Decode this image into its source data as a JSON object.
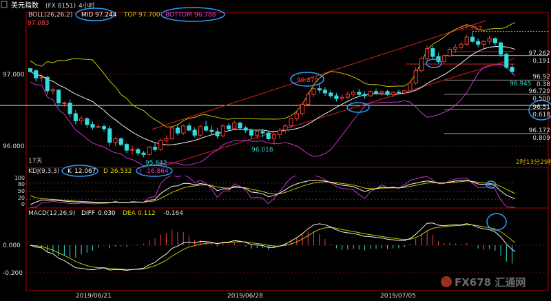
{
  "header": {
    "title": "美元指数",
    "symbol": "(FX 8151)",
    "period": "4小时"
  },
  "boll": {
    "label": "BOLL(26,26,2)",
    "mid_label": "MID",
    "mid": "97.244",
    "top_label": "TOP",
    "top": "97.700",
    "bottom_label": "BOTTOM",
    "bottom": "96.788"
  },
  "kdj": {
    "label": "KDJ(9,3,3)",
    "k_label": "K",
    "k": "12.067",
    "d_label": "D",
    "d": "26.532",
    "j_label": "J",
    "j": "-16.864"
  },
  "macd": {
    "label": "MACD(12,26,9)",
    "diff_label": "DIFF",
    "diff": "0.030",
    "dea_label": "DEA",
    "dea": "0.112",
    "macd": "-0.164"
  },
  "price_axis": [
    "97.000",
    "96.000"
  ],
  "kdj_axis": [
    "100",
    "80",
    "50",
    "20",
    "0"
  ],
  "macd_axis": [
    "0.000",
    "-0.200"
  ],
  "dates": [
    "2019/06/21",
    "2019/06/28",
    "2019/07/05"
  ],
  "annotations": {
    "left_high": "97.083",
    "low": "95.842",
    "mid_low": "96.018",
    "mid_high": "96.879",
    "right_high": "97.593",
    "last": "96.945",
    "days": "17天",
    "countdown": "2时13分29秒"
  },
  "fib_levels": [
    "97.262",
    "0.191",
    "96.92",
    "0.38",
    "96.720",
    "0.500",
    "96.51",
    "0.618",
    "96.172",
    "0.809"
  ],
  "watermark": "FX678 汇通网",
  "colors": {
    "up": "#ff3b3b",
    "down": "#33dddd",
    "mid": "#f0f0f0",
    "top": "#c8c800",
    "bottom": "#cc33cc",
    "channel": "#e02020",
    "highlight": "#2aa0ff"
  },
  "chart_data": {
    "type": "candlestick",
    "x_labels": [
      "2019/06/21",
      "2019/06/28",
      "2019/07/05"
    ],
    "ylim": [
      95.7,
      97.75
    ],
    "candles": [
      [
        97.08,
        97.08,
        97.06,
        97.04
      ],
      [
        97.05,
        97.07,
        96.9,
        96.95
      ],
      [
        96.95,
        96.98,
        96.9,
        96.96
      ],
      [
        96.96,
        96.97,
        96.72,
        96.77
      ],
      [
        96.77,
        96.82,
        96.72,
        96.79
      ],
      [
        96.78,
        96.79,
        96.55,
        96.6
      ],
      [
        96.6,
        96.62,
        96.55,
        96.6
      ],
      [
        96.6,
        96.65,
        96.4,
        96.45
      ],
      [
        96.45,
        96.5,
        96.3,
        96.35
      ],
      [
        96.35,
        96.42,
        96.3,
        96.38
      ],
      [
        96.38,
        96.4,
        96.25,
        96.3
      ],
      [
        96.3,
        96.34,
        96.23,
        96.26
      ],
      [
        96.26,
        96.3,
        96.25,
        96.27
      ],
      [
        96.27,
        96.3,
        96.2,
        96.24
      ],
      [
        96.24,
        96.28,
        96.0,
        96.05
      ],
      [
        96.05,
        96.12,
        96.0,
        96.1
      ],
      [
        96.1,
        96.12,
        96.0,
        96.02
      ],
      [
        96.02,
        96.04,
        95.9,
        95.94
      ],
      [
        95.94,
        96.0,
        95.88,
        95.95
      ],
      [
        95.95,
        95.98,
        95.86,
        95.9
      ],
      [
        95.9,
        95.93,
        95.84,
        95.88
      ],
      [
        95.88,
        96.0,
        95.86,
        95.98
      ],
      [
        95.98,
        96.05,
        95.92,
        95.95
      ],
      [
        95.95,
        96.1,
        95.93,
        96.08
      ],
      [
        96.08,
        96.15,
        96.05,
        96.1
      ],
      [
        96.1,
        96.28,
        96.08,
        96.25
      ],
      [
        96.25,
        96.3,
        96.15,
        96.18
      ],
      [
        96.18,
        96.3,
        96.15,
        96.28
      ],
      [
        96.28,
        96.32,
        96.2,
        96.22
      ],
      [
        96.22,
        96.26,
        96.12,
        96.15
      ],
      [
        96.15,
        96.3,
        96.13,
        96.27
      ],
      [
        96.27,
        96.35,
        96.2,
        96.22
      ],
      [
        96.22,
        96.28,
        96.15,
        96.2
      ],
      [
        96.2,
        96.25,
        96.1,
        96.14
      ],
      [
        96.14,
        96.3,
        96.12,
        96.28
      ],
      [
        96.28,
        96.32,
        96.2,
        96.24
      ],
      [
        96.24,
        96.35,
        96.22,
        96.32
      ],
      [
        96.32,
        96.34,
        96.22,
        96.25
      ],
      [
        96.25,
        96.28,
        96.18,
        96.22
      ],
      [
        96.22,
        96.25,
        96.1,
        96.15
      ],
      [
        96.15,
        96.22,
        96.1,
        96.2
      ],
      [
        96.2,
        96.24,
        96.12,
        96.18
      ],
      [
        96.18,
        96.2,
        96.08,
        96.1
      ],
      [
        96.1,
        96.18,
        96.02,
        96.16
      ],
      [
        96.16,
        96.25,
        96.1,
        96.22
      ],
      [
        96.22,
        96.3,
        96.18,
        96.28
      ],
      [
        96.28,
        96.4,
        96.25,
        96.38
      ],
      [
        96.38,
        96.48,
        96.35,
        96.45
      ],
      [
        96.45,
        96.6,
        96.42,
        96.58
      ],
      [
        96.58,
        96.75,
        96.55,
        96.72
      ],
      [
        96.72,
        96.82,
        96.68,
        96.8
      ],
      [
        96.8,
        96.88,
        96.74,
        96.78
      ],
      [
        96.78,
        96.82,
        96.7,
        96.74
      ],
      [
        96.74,
        96.78,
        96.66,
        96.7
      ],
      [
        96.7,
        96.74,
        96.62,
        96.66
      ],
      [
        96.66,
        96.72,
        96.62,
        96.68
      ],
      [
        96.68,
        96.76,
        96.65,
        96.72
      ],
      [
        96.72,
        96.78,
        96.68,
        96.75
      ],
      [
        96.75,
        96.8,
        96.7,
        96.72
      ],
      [
        96.72,
        96.76,
        96.66,
        96.7
      ],
      [
        96.7,
        96.78,
        96.68,
        96.76
      ],
      [
        96.76,
        96.8,
        96.72,
        96.74
      ],
      [
        96.74,
        96.78,
        96.7,
        96.76
      ],
      [
        96.76,
        96.78,
        96.7,
        96.72
      ],
      [
        96.72,
        96.76,
        96.68,
        96.75
      ],
      [
        96.75,
        96.78,
        96.72,
        96.74
      ],
      [
        96.74,
        96.78,
        96.72,
        96.77
      ],
      [
        96.77,
        96.9,
        96.75,
        96.88
      ],
      [
        96.88,
        97.1,
        96.85,
        97.05
      ],
      [
        97.05,
        97.25,
        97.02,
        97.22
      ],
      [
        97.22,
        97.4,
        97.18,
        97.36
      ],
      [
        97.36,
        97.4,
        97.2,
        97.25
      ],
      [
        97.25,
        97.3,
        97.15,
        97.18
      ],
      [
        97.18,
        97.28,
        97.15,
        97.26
      ],
      [
        97.26,
        97.38,
        97.24,
        97.35
      ],
      [
        97.35,
        97.42,
        97.3,
        97.38
      ],
      [
        97.38,
        97.45,
        97.34,
        97.42
      ],
      [
        97.42,
        97.55,
        97.4,
        97.52
      ],
      [
        97.52,
        97.59,
        97.44,
        97.46
      ],
      [
        97.46,
        97.5,
        97.38,
        97.42
      ],
      [
        97.42,
        97.48,
        97.36,
        97.46
      ],
      [
        97.46,
        97.54,
        97.42,
        97.5
      ],
      [
        97.5,
        97.52,
        97.4,
        97.44
      ],
      [
        97.44,
        97.46,
        97.24,
        97.28
      ],
      [
        97.28,
        97.3,
        97.08,
        97.1
      ],
      [
        97.1,
        97.14,
        97.0,
        97.04
      ],
      [
        97.04,
        97.08,
        96.96,
        97.0
      ],
      [
        97.0,
        97.02,
        96.93,
        96.945
      ]
    ]
  }
}
